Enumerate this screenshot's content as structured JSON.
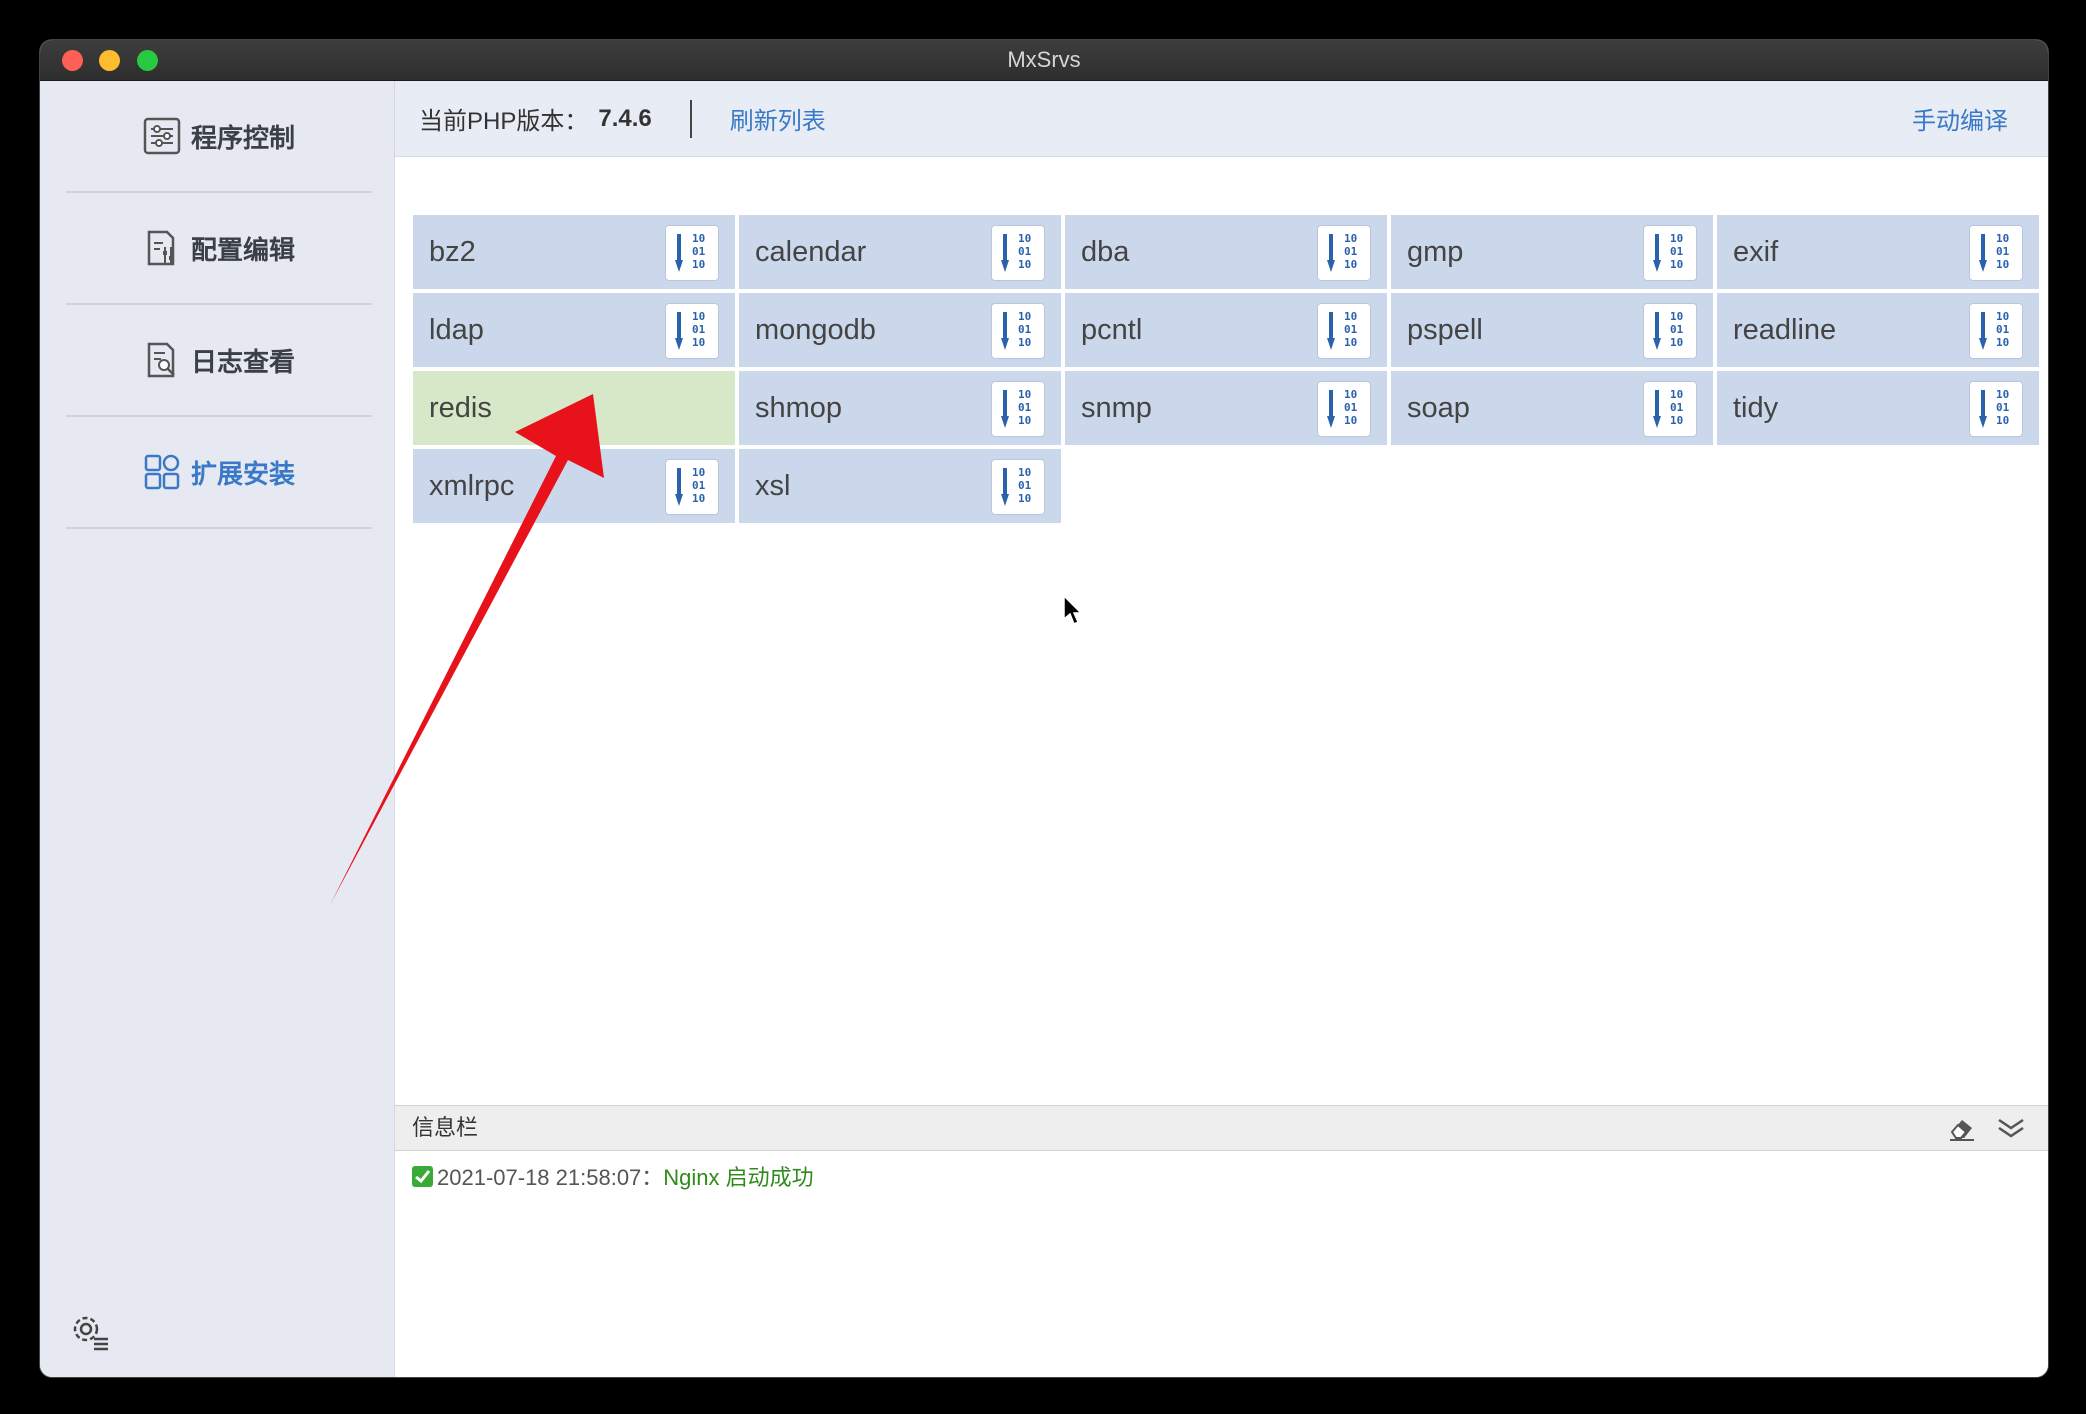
{
  "window": {
    "title": "MxSrvs"
  },
  "sidebar": {
    "items": [
      {
        "label": "程序控制",
        "icon": "sliders-icon"
      },
      {
        "label": "配置编辑",
        "icon": "config-edit-icon"
      },
      {
        "label": "日志查看",
        "icon": "log-search-icon"
      },
      {
        "label": "扩展安装",
        "icon": "extensions-grid-icon",
        "active": true
      }
    ],
    "settings_icon": "gear-list-icon"
  },
  "toolbar": {
    "php_version_label": "当前PHP版本：",
    "php_version": "7.4.6",
    "refresh_label": "刷新列表",
    "compile_label": "手动编译"
  },
  "extensions": [
    {
      "name": "bz2",
      "installed": false
    },
    {
      "name": "calendar",
      "installed": false
    },
    {
      "name": "dba",
      "installed": false
    },
    {
      "name": "gmp",
      "installed": false
    },
    {
      "name": "exif",
      "installed": false
    },
    {
      "name": "ldap",
      "installed": false
    },
    {
      "name": "mongodb",
      "installed": false
    },
    {
      "name": "pcntl",
      "installed": false
    },
    {
      "name": "pspell",
      "installed": false
    },
    {
      "name": "readline",
      "installed": false
    },
    {
      "name": "redis",
      "installed": true
    },
    {
      "name": "shmop",
      "installed": false
    },
    {
      "name": "snmp",
      "installed": false
    },
    {
      "name": "soap",
      "installed": false
    },
    {
      "name": "tidy",
      "installed": false
    },
    {
      "name": "xmlrpc",
      "installed": false
    },
    {
      "name": "xsl",
      "installed": false
    }
  ],
  "install_icon": {
    "bits": [
      "10",
      "01",
      "10"
    ],
    "name": "install-download-icon"
  },
  "infobar": {
    "title": "信息栏",
    "erase_icon": "eraser-icon",
    "collapse_icon": "double-chevron-down-icon"
  },
  "log": [
    {
      "timestamp": "2021-07-18 21:58:07：",
      "message": "Nginx 启动成功",
      "status": "success"
    }
  ],
  "colors": {
    "accent": "#3a79c7",
    "ext_bg": "#cbd8ec",
    "ext_installed_bg": "#d6e8c8",
    "success": "#2e8b1c",
    "annotation_arrow": "#e8121b"
  }
}
